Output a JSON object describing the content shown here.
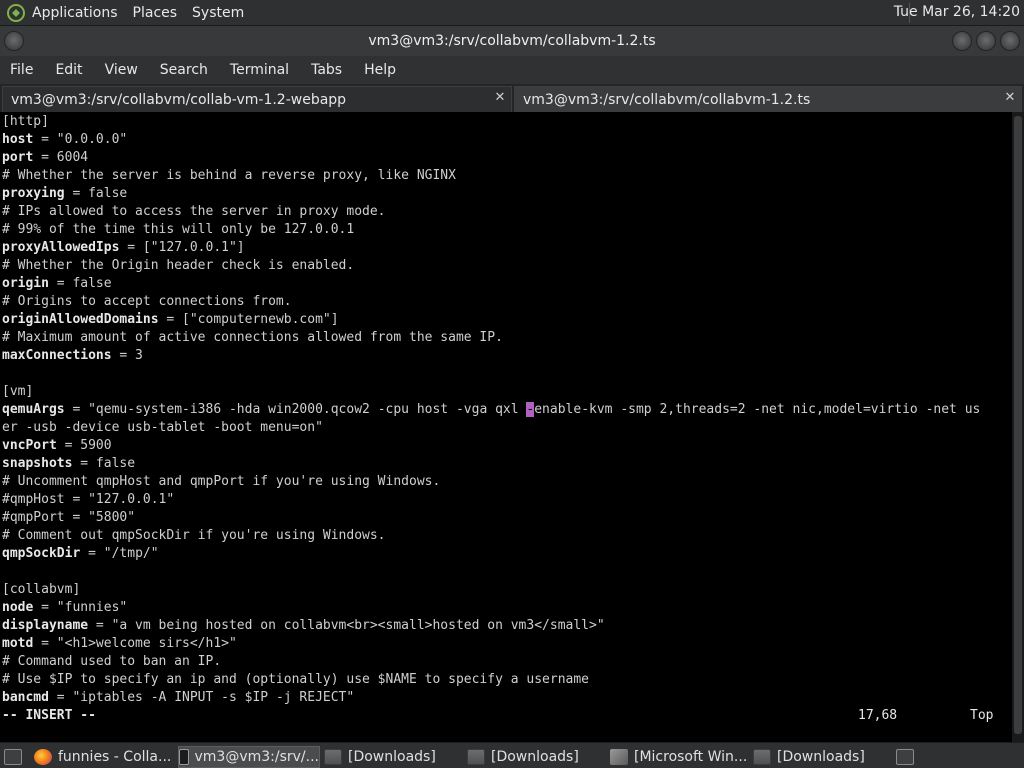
{
  "top_panel": {
    "menus": [
      "Applications",
      "Places",
      "System"
    ],
    "clock": "Tue Mar 26, 14:20"
  },
  "window": {
    "title": "vm3@vm3:/srv/collabvm/collabvm-1.2.ts"
  },
  "menubar": [
    "File",
    "Edit",
    "View",
    "Search",
    "Terminal",
    "Tabs",
    "Help"
  ],
  "tabs": [
    {
      "label": "vm3@vm3:/srv/collabvm/collab-vm-1.2-webapp"
    },
    {
      "label": "vm3@vm3:/srv/collabvm/collabvm-1.2.ts"
    }
  ],
  "editor": {
    "lines": [
      {
        "k": "",
        "rest": "[http]"
      },
      {
        "k": "host",
        "rest": " = \"0.0.0.0\""
      },
      {
        "k": "port",
        "rest": " = 6004"
      },
      {
        "k": "",
        "rest": "# Whether the server is behind a reverse proxy, like NGINX"
      },
      {
        "k": "proxying",
        "rest": " = false"
      },
      {
        "k": "",
        "rest": "# IPs allowed to access the server in proxy mode."
      },
      {
        "k": "",
        "rest": "# 99% of the time this will only be 127.0.0.1"
      },
      {
        "k": "proxyAllowedIps",
        "rest": " = [\"127.0.0.1\"]"
      },
      {
        "k": "",
        "rest": "# Whether the Origin header check is enabled."
      },
      {
        "k": "origin",
        "rest": " = false"
      },
      {
        "k": "",
        "rest": "# Origins to accept connections from."
      },
      {
        "k": "originAllowedDomains",
        "rest": " = [\"computernewb.com\"]"
      },
      {
        "k": "",
        "rest": "# Maximum amount of active connections allowed from the same IP."
      },
      {
        "k": "maxConnections",
        "rest": " = 3"
      },
      {
        "k": "",
        "rest": ""
      },
      {
        "k": "",
        "rest": "[vm]"
      },
      {
        "k": "qemuArgs",
        "rest": " = \"qemu-system-i386 -hda win2000.qcow2 -cpu host -vga qxl ",
        "cursor": "-",
        "after": "enable-kvm -smp 2,threads=2 -net nic,model=virtio -net us"
      },
      {
        "k": "",
        "rest": "er -usb -device usb-tablet -boot menu=on\""
      },
      {
        "k": "vncPort",
        "rest": " = 5900"
      },
      {
        "k": "snapshots",
        "rest": " = false"
      },
      {
        "k": "",
        "rest": "# Uncomment qmpHost and qmpPort if you're using Windows."
      },
      {
        "k": "",
        "rest": "#qmpHost = \"127.0.0.1\""
      },
      {
        "k": "",
        "rest": "#qmpPort = \"5800\""
      },
      {
        "k": "",
        "rest": "# Comment out qmpSockDir if you're using Windows."
      },
      {
        "k": "qmpSockDir",
        "rest": " = \"/tmp/\""
      },
      {
        "k": "",
        "rest": ""
      },
      {
        "k": "",
        "rest": "[collabvm]"
      },
      {
        "k": "node",
        "rest": " = \"funnies\""
      },
      {
        "k": "displayname",
        "rest": " = \"a vm being hosted on collabvm<br><small>hosted on vm3</small>\""
      },
      {
        "k": "motd",
        "rest": " = \"<h1>welcome sirs</h1>\""
      },
      {
        "k": "",
        "rest": "# Command used to ban an IP."
      },
      {
        "k": "",
        "rest": "# Use $IP to specify an ip and (optionally) use $NAME to specify a username"
      },
      {
        "k": "bancmd",
        "rest": " = \"iptables -A INPUT -s $IP -j REJECT\""
      }
    ],
    "mode": "-- INSERT --",
    "position": "17,68",
    "scroll": "Top"
  },
  "taskbar": {
    "items": [
      {
        "label": "funnies - Colla...",
        "icon": "firefox-icon"
      },
      {
        "label": "vm3@vm3:/srv/...",
        "icon": "terminal-icon"
      },
      {
        "label": "[Downloads]",
        "icon": "folder-icon"
      },
      {
        "label": "[Downloads]",
        "icon": "folder-icon"
      },
      {
        "label": "[Microsoft Win...",
        "icon": "window-icon"
      },
      {
        "label": "[Downloads]",
        "icon": "folder-icon"
      }
    ]
  }
}
